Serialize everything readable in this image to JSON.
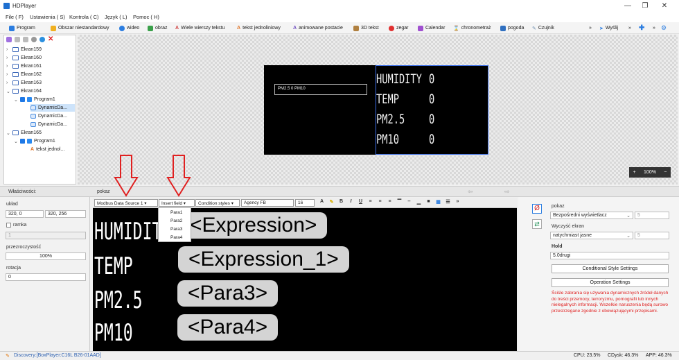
{
  "window": {
    "title": "HDPlayer"
  },
  "menu": [
    "File ( F)",
    "Ustawienia ( S)",
    "Kontrola ( C)",
    "Język ( L)",
    "Pomoc ( H)"
  ],
  "toolbar": [
    "Program",
    "Obszar niestandardowy",
    "wideo",
    "obraz",
    "Wiele wierszy tekstu",
    "tekst jednoliniowy",
    "animowane postacie",
    "3D tekst",
    "zegar",
    "Calendar",
    "chronometraż",
    "pogoda",
    "Czujnik",
    "Wyślij"
  ],
  "tree": {
    "screens": [
      "Ekran159",
      "Ekran160",
      "Ekran161",
      "Ekran162",
      "Ekran163",
      "Ekran164"
    ],
    "program": "Program1",
    "dynamic": [
      "DynamicDa...",
      "DynamicDa...",
      "DynamicDa..."
    ],
    "screen2": "Ekran165",
    "program2": "Program1",
    "text_item": "tekst jednol..."
  },
  "preview": {
    "pm_label": "PM2.5 0 PM10",
    "rows": [
      {
        "label": "HUMIDITY",
        "value": "0"
      },
      {
        "label": "TEMP",
        "value": "0"
      },
      {
        "label": "PM2.5",
        "value": "0"
      },
      {
        "label": "PM10",
        "value": "0"
      }
    ],
    "zoom": "100%",
    "zoom_in": "+",
    "zoom_out": "−"
  },
  "props": {
    "header": "Właściwości:",
    "tab": "pokaz",
    "layout_label": "układ",
    "pos": "320, 0",
    "size": "320, 256",
    "frame_label": "ramka",
    "frame_value": "1",
    "transparency_label": "przezroczystość",
    "transparency_value": "100%",
    "rotation_label": "rotacja",
    "rotation_value": "0"
  },
  "editor": {
    "source": "Modbus Data Source 1",
    "insert": "Insert field",
    "condition": "Condition styles",
    "font": "Agency FB",
    "size": "16",
    "dropdown": [
      "Para1",
      "Para2",
      "Para3",
      "Para4"
    ],
    "lines": [
      {
        "label": "HUMIDITY",
        "pill": "<Expression>"
      },
      {
        "label": "TEMP",
        "pill": "<Expression_1>"
      },
      {
        "label": "PM2.5",
        "pill": "<Para3>"
      },
      {
        "label": "PM10",
        "pill": "<Para4>"
      }
    ]
  },
  "right": {
    "show_label": "pokaz",
    "show_value": "Bezpośredni wyświetlacz",
    "show_num": "5",
    "clear_label": "Wyczyść ekran",
    "clear_value": "natychmiast jasne",
    "clear_num": "5",
    "hold_label": "Hold",
    "hold_value": "5.0drugi",
    "cond_btn": "Conditional Style Settings",
    "op_btn": "Operation Settings",
    "warning": "Ściśle zabrania się używania dynamicznych źródeł danych do treści przemocy, terroryzmu, pornografii lub innych nielegalnych informacji. Wszelkie naruszenia będą surowo przestrzegane zgodnie z obowiązującymi przepisami."
  },
  "status": {
    "discovery": "Discovery:[BoxPlayer:C16L B26-01AAD]",
    "cpu": "CPU: 23.5%",
    "disk": "CDysk: 46.3%",
    "app": "APP: 46.3%"
  }
}
